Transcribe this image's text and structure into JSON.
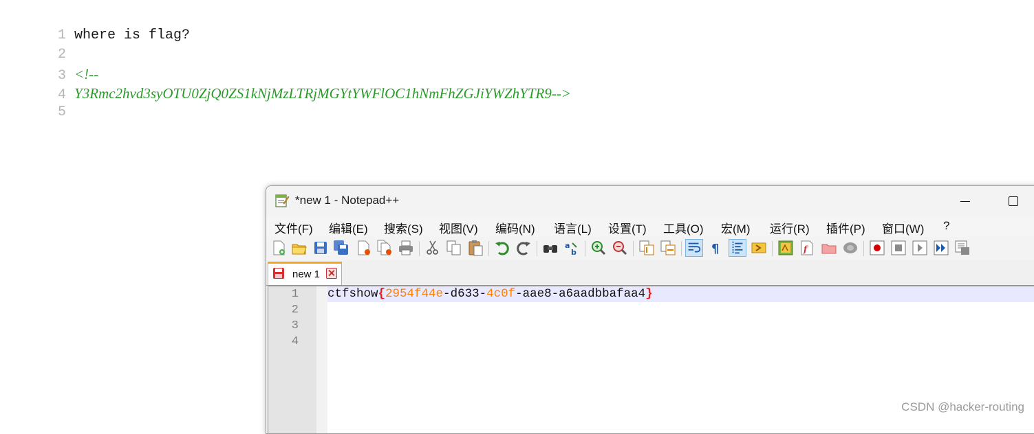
{
  "source_view": {
    "lines": [
      {
        "num": "1",
        "text": "where is flag?",
        "style": "plain"
      },
      {
        "num": "2",
        "text": "",
        "style": "plain"
      },
      {
        "num": "3",
        "text": "<!--",
        "style": "comment"
      },
      {
        "num": "4",
        "text": "Y3Rmc2hvd3syOTU0ZjQ0ZS1kNjMzLTRjMGYtYWFlOC1hNmFhZGJiYWZhYTR9-->",
        "style": "comment"
      },
      {
        "num": "5",
        "text": "",
        "style": "plain"
      }
    ]
  },
  "notepad": {
    "title": "*new 1 - Notepad++",
    "menu": [
      "文件(F)",
      "编辑(E)",
      "搜索(S)",
      "视图(V)",
      "编码(N)",
      "语言(L)",
      "设置(T)",
      "工具(O)",
      "宏(M)",
      "运行(R)",
      "插件(P)",
      "窗口(W)",
      "?"
    ],
    "toolbar_icons": [
      "new-file-icon",
      "open-file-icon",
      "save-icon",
      "save-all-icon",
      "close-icon",
      "close-all-icon",
      "print-icon",
      "cut-icon",
      "copy-icon",
      "paste-icon",
      "undo-icon",
      "redo-icon",
      "find-icon",
      "replace-icon",
      "zoom-in-icon",
      "zoom-out-icon",
      "sync-vertical-icon",
      "sync-horizontal-icon",
      "word-wrap-icon",
      "show-all-chars-icon",
      "indent-guide-icon",
      "user-defined-lang-icon",
      "doc-map-icon",
      "function-list-icon",
      "folder-workspace-icon",
      "monitoring-icon",
      "record-macro-icon",
      "stop-record-icon",
      "play-macro-icon",
      "run-macro-multiple-icon",
      "save-macro-icon"
    ],
    "tab": {
      "label": "new 1"
    },
    "editor": {
      "line_numbers": [
        "1",
        "2",
        "3",
        "4"
      ],
      "line1": {
        "prefix": "ctfshow",
        "open": "{",
        "p1": "2954f44e",
        "d1": "-",
        "p2": "d633",
        "d2": "-",
        "p3": "4c0f",
        "d3": "-",
        "p4": "aae8",
        "d4": "-",
        "p5": "a6aadbbafaa4",
        "close": "}"
      }
    }
  },
  "watermark": "CSDN @hacker-routing",
  "colors": {
    "comment": "#2a9a2a",
    "brace": "#e02020",
    "number": "#ff8000",
    "tab_accent": "#f5a623",
    "current_line": "#e8e8ff"
  }
}
